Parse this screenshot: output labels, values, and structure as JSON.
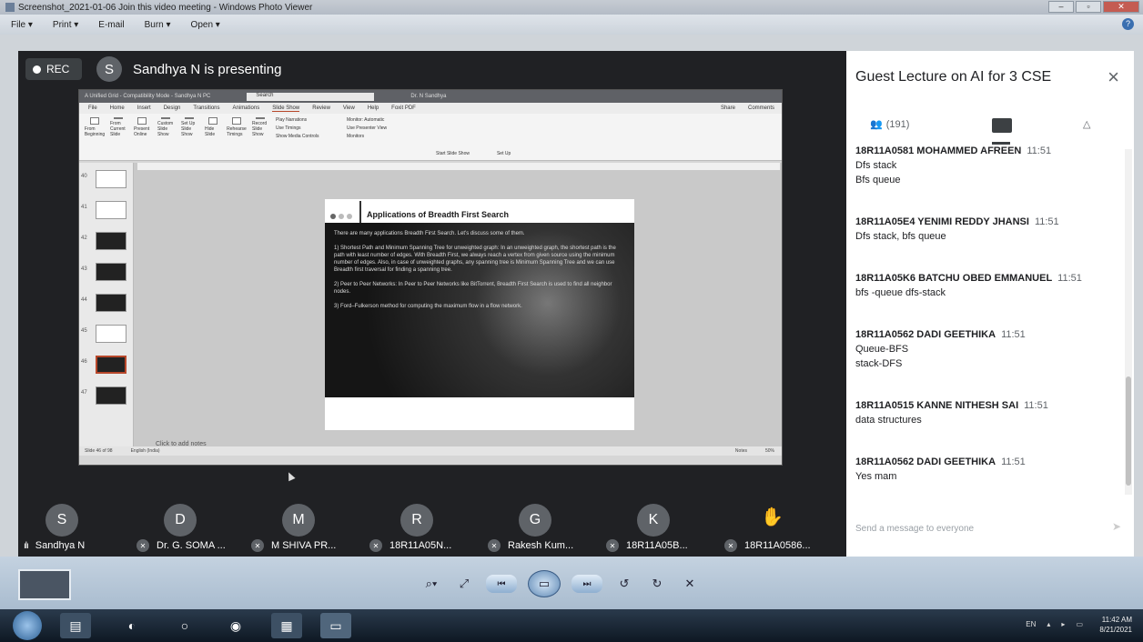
{
  "viewer": {
    "title": "Screenshot_2021-01-06 Join this video meeting - Windows Photo Viewer",
    "menu": [
      "File ▾",
      "Print ▾",
      "E-mail",
      "Burn ▾",
      "Open ▾"
    ],
    "help": "?"
  },
  "meet": {
    "rec_label": "REC",
    "presenter_initial": "S",
    "presenter_text": "Sandhya N is presenting",
    "participants": [
      {
        "initial": "S",
        "name": "Sandhya N",
        "muted": false
      },
      {
        "initial": "D",
        "name": "Dr. G. SOMA ...",
        "muted": true
      },
      {
        "initial": "M",
        "name": "M SHIVA PR...",
        "muted": true
      },
      {
        "initial": "R",
        "name": "18R11A05N...",
        "muted": true
      },
      {
        "initial": "G",
        "name": "Rakesh Kum...",
        "muted": true
      },
      {
        "initial": "K",
        "name": "18R11A05B...",
        "muted": true
      },
      {
        "initial": "",
        "name": "18R11A0586...",
        "muted": true
      }
    ]
  },
  "ppt": {
    "window_title": "A Unified Grid - Compatibility Mode - Sandhya N PC",
    "search": "Search",
    "user": "Dr. N Sandhya",
    "tabs": [
      "File",
      "Home",
      "Insert",
      "Design",
      "Transitions",
      "Animations",
      "Slide Show",
      "Review",
      "View",
      "Help",
      "Foxit PDF"
    ],
    "active_tab": "Slide Show",
    "share": "Share",
    "comments": "Comments",
    "ribbon_groups": [
      "Start Slide Show",
      "Set Up",
      "Monitors"
    ],
    "ribbon_buttons": [
      "From Beginning",
      "From Current Slide",
      "Present Online",
      "Custom Slide Show",
      "Set Up Slide Show",
      "Hide Slide",
      "Rehearse Timings",
      "Record Slide Show"
    ],
    "ribbon_checks": [
      "Play Narrations",
      "Use Timings",
      "Show Media Controls",
      "Use Presenter View"
    ],
    "monitor": "Monitor: Automatic",
    "slide_numbers": [
      "40",
      "41",
      "42",
      "43",
      "44",
      "45",
      "46",
      "47"
    ],
    "slide_title": "Applications of Breadth First Search",
    "slide_intro": "There are many applications Breadth First Search. Let's discuss some of them.",
    "slide_p1": "1) Shortest Path and Minimum Spanning Tree for unweighted graph: In an unweighted graph, the shortest path is the path with least number of edges. With Breadth First, we always reach a vertex from given source using the minimum number of edges. Also, in case of unweighted graphs, any spanning tree is Minimum Spanning Tree and we can use Breadth first traversal for finding a spanning tree.",
    "slide_p2": "2) Peer to Peer Networks: In Peer to Peer Networks like BitTorrent, Breadth First Search is used to find all neighbor nodes.",
    "slide_p3": "3) Ford–Fulkerson method for computing the maximum flow in a flow network.",
    "notes": "Click to add notes",
    "status_left": "Slide 46 of 98",
    "status_lang": "English (India)",
    "status_notes": "Notes",
    "zoom": "50%"
  },
  "chat": {
    "title": "Guest Lecture on AI for 3 CSE",
    "people_count": "(191)",
    "messages": [
      {
        "sender": "18R11A0581 MOHAMMED AFREEN",
        "time": "11:51",
        "lines": [
          "Dfs stack",
          "Bfs queue"
        ]
      },
      {
        "sender": "18R11A05E4 YENIMI REDDY JHANSI",
        "time": "11:51",
        "lines": [
          "Dfs stack, bfs queue"
        ]
      },
      {
        "sender": "18R11A05K6 BATCHU OBED EMMANUEL",
        "time": "11:51",
        "lines": [
          "bfs -queue dfs-stack"
        ]
      },
      {
        "sender": "18R11A0562 DADI GEETHIKA",
        "time": "11:51",
        "lines": [
          "Queue-BFS",
          "stack-DFS"
        ]
      },
      {
        "sender": "18R11A0515 KANNE NITHESH SAI",
        "time": "11:51",
        "lines": [
          "data structures"
        ]
      },
      {
        "sender": "18R11A0562 DADI GEETHIKA",
        "time": "11:51",
        "lines": [
          "Yes mam"
        ]
      }
    ],
    "send_placeholder": "Send a message to everyone"
  },
  "taskbar": {
    "lang": "EN",
    "time": "11:42 AM",
    "date": "8/21/2021"
  },
  "colors": {
    "meet_bg": "#202124",
    "panel_bg": "#ffffff",
    "taskbar": "#0e1823"
  }
}
